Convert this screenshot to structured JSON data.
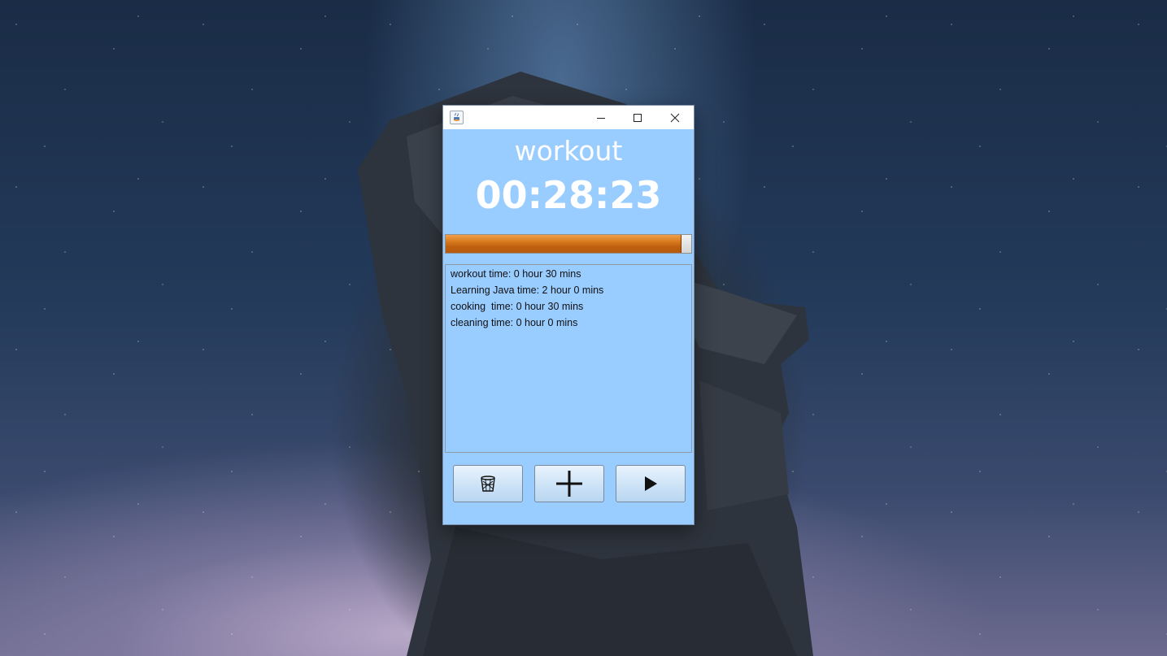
{
  "window": {
    "icon": "java-icon",
    "controls": [
      "minimize-icon",
      "maximize-icon",
      "close-icon"
    ]
  },
  "current_task": {
    "name": "workout",
    "time": "00:28:23",
    "progress": 0.96
  },
  "tasks": [
    {
      "label": "workout time: 0 hour 30 mins"
    },
    {
      "label": "Learning Java time: 2 hour 0 mins"
    },
    {
      "label": "cooking  time: 0 hour 30 mins"
    },
    {
      "label": "cleaning time: 0 hour 0 mins"
    }
  ],
  "buttons": {
    "delete_icon": "trash-icon",
    "add_icon": "plus-icon",
    "play_icon": "play-icon"
  },
  "colors": {
    "background": "#99ccff",
    "progress_fill": "#d97d1f",
    "title_text": "#ffffff"
  }
}
